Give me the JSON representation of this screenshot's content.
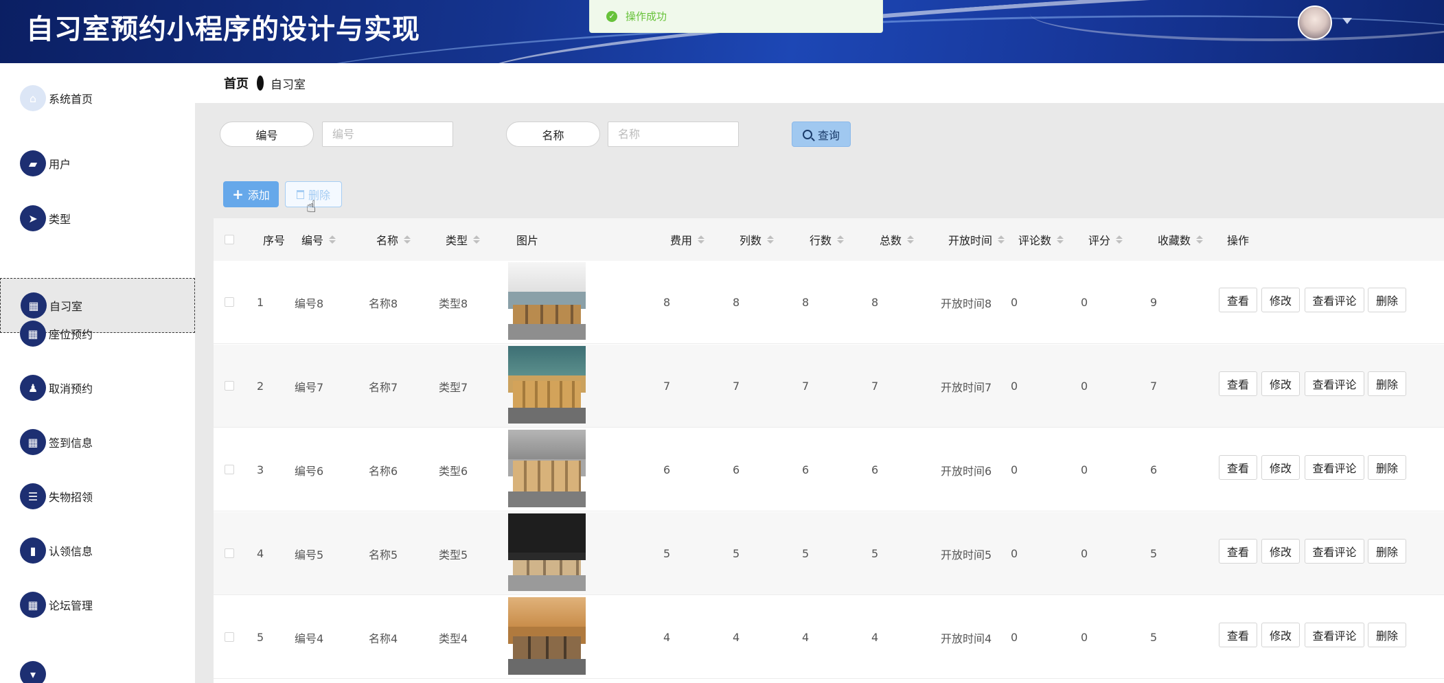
{
  "header": {
    "title": "自习室预约小程序的设计与实现",
    "avatar_icon": "user-avatar",
    "dropdown_icon": "caret-down-icon"
  },
  "toast": {
    "message": "操作成功",
    "icon": "check-circle-icon",
    "color": "#67c23a"
  },
  "sidebar": {
    "items": [
      {
        "label": "系统首页",
        "icon": "home-icon"
      },
      {
        "label": "用户",
        "icon": "briefcase-icon"
      },
      {
        "label": "类型",
        "icon": "send-icon"
      },
      {
        "label": "自习室",
        "icon": "grid-icon",
        "active": true
      },
      {
        "label": "座位预约",
        "icon": "grid-icon"
      },
      {
        "label": "取消预约",
        "icon": "stamp-icon"
      },
      {
        "label": "签到信息",
        "icon": "grid-icon"
      },
      {
        "label": "失物招领",
        "icon": "list-icon"
      },
      {
        "label": "认领信息",
        "icon": "book-icon"
      },
      {
        "label": "论坛管理",
        "icon": "grid-icon"
      }
    ]
  },
  "breadcrumb": {
    "home": "首页",
    "current": "自习室"
  },
  "search": {
    "fields": [
      {
        "label": "编号",
        "placeholder": "编号",
        "value": ""
      },
      {
        "label": "名称",
        "placeholder": "名称",
        "value": ""
      }
    ],
    "query_label": "查询"
  },
  "toolbar": {
    "add_label": "添加",
    "delete_label": "删除"
  },
  "table": {
    "columns": [
      "序号",
      "编号",
      "名称",
      "类型",
      "图片",
      "费用",
      "列数",
      "行数",
      "总数",
      "开放时间",
      "评论数",
      "评分",
      "收藏数",
      "操作"
    ],
    "rows": [
      {
        "index": "1",
        "code": "编号8",
        "name": "名称8",
        "type": "类型8",
        "fee": "8",
        "cols": "8",
        "rows": "8",
        "total": "8",
        "open": "开放时间8",
        "comments": "0",
        "score": "0",
        "favs": "9"
      },
      {
        "index": "2",
        "code": "编号7",
        "name": "名称7",
        "type": "类型7",
        "fee": "7",
        "cols": "7",
        "rows": "7",
        "total": "7",
        "open": "开放时间7",
        "comments": "0",
        "score": "0",
        "favs": "7"
      },
      {
        "index": "3",
        "code": "编号6",
        "name": "名称6",
        "type": "类型6",
        "fee": "6",
        "cols": "6",
        "rows": "6",
        "total": "6",
        "open": "开放时间6",
        "comments": "0",
        "score": "0",
        "favs": "6"
      },
      {
        "index": "4",
        "code": "编号5",
        "name": "名称5",
        "type": "类型5",
        "fee": "5",
        "cols": "5",
        "rows": "5",
        "total": "5",
        "open": "开放时间5",
        "comments": "0",
        "score": "0",
        "favs": "5"
      },
      {
        "index": "5",
        "code": "编号4",
        "name": "名称4",
        "type": "类型4",
        "fee": "4",
        "cols": "4",
        "rows": "4",
        "total": "4",
        "open": "开放时间4",
        "comments": "0",
        "score": "0",
        "favs": "5"
      }
    ],
    "actions": [
      "查看",
      "修改",
      "查看评论",
      "删除"
    ]
  },
  "colors": {
    "header_dark": "#0b1f63",
    "sidebar_icon": "#1d2f72",
    "primary": "#66a8ea",
    "success": "#67c23a"
  }
}
